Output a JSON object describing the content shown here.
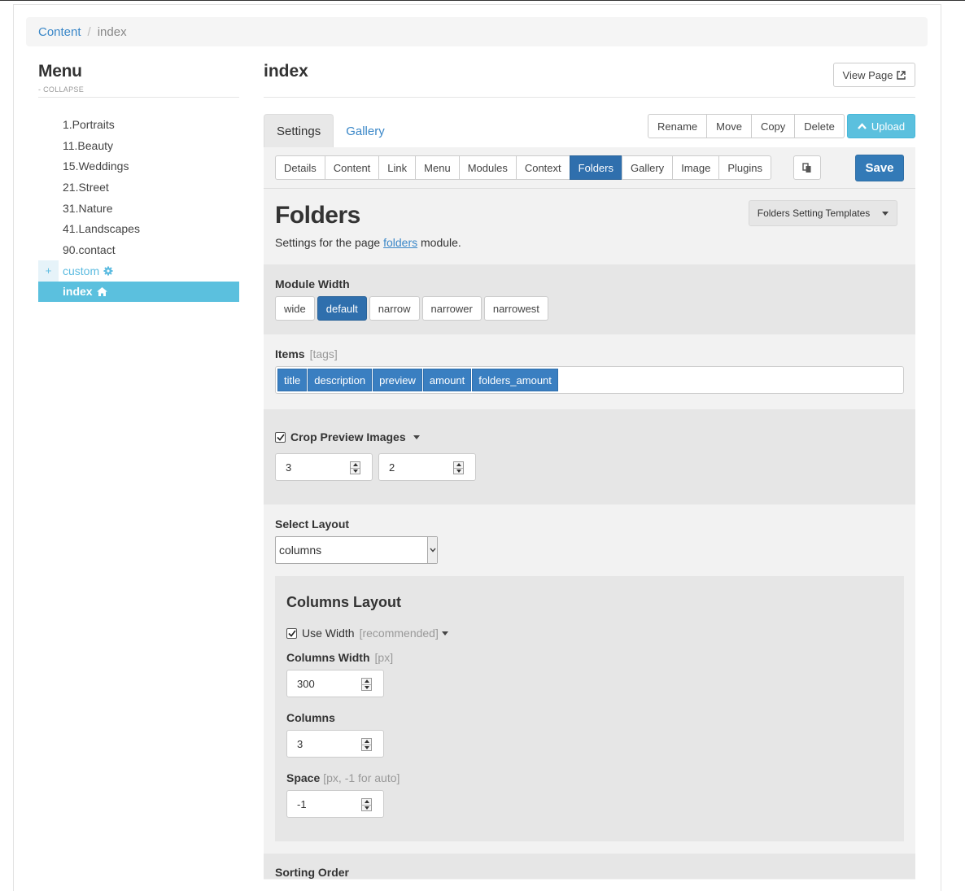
{
  "breadcrumb": {
    "root": "Content",
    "separator": "/",
    "current": "index"
  },
  "sidebar": {
    "title": "Menu",
    "collapse": "- COLLAPSE",
    "items": [
      {
        "label": "1.Portraits"
      },
      {
        "label": "11.Beauty"
      },
      {
        "label": "15.Weddings"
      },
      {
        "label": "21.Street"
      },
      {
        "label": "31.Nature"
      },
      {
        "label": "41.Landscapes"
      },
      {
        "label": "90.contact"
      },
      {
        "label": "custom",
        "expander": "+"
      },
      {
        "label": "index"
      }
    ]
  },
  "header": {
    "title": "index",
    "view_page": "View Page"
  },
  "tabs": {
    "settings": "Settings",
    "gallery": "Gallery"
  },
  "actions": {
    "rename": "Rename",
    "move": "Move",
    "copy": "Copy",
    "delete": "Delete",
    "upload": "Upload"
  },
  "subtabs": [
    "Details",
    "Content",
    "Link",
    "Menu",
    "Modules",
    "Context",
    "Folders",
    "Gallery",
    "Image",
    "Plugins"
  ],
  "save": "Save",
  "module": {
    "title": "Folders",
    "desc_prefix": "Settings for the page ",
    "desc_link": "folders",
    "desc_suffix": " module.",
    "templates": "Folders Setting Templates"
  },
  "module_width": {
    "label": "Module Width",
    "options": [
      "wide",
      "default",
      "narrow",
      "narrower",
      "narrowest"
    ],
    "selected": "default"
  },
  "items": {
    "label": "Items",
    "hint": "[tags]",
    "tags": [
      "title",
      "description",
      "preview",
      "amount",
      "folders_amount"
    ]
  },
  "crop": {
    "label": "Crop Preview Images",
    "checked": true,
    "value1": "3",
    "value2": "2"
  },
  "layout": {
    "label": "Select Layout",
    "value": "columns"
  },
  "columns_layout": {
    "title": "Columns Layout",
    "use_width": {
      "label": "Use Width",
      "hint": "[recommended]",
      "checked": true
    },
    "width": {
      "label": "Columns Width",
      "hint": "[px]",
      "value": "300"
    },
    "columns": {
      "label": "Columns",
      "value": "3"
    },
    "space": {
      "label": "Space",
      "hint": "[px, -1 for auto]",
      "value": "-1"
    }
  },
  "sorting": {
    "label": "Sorting Order"
  },
  "colors": {
    "accent": "#3a87c8",
    "primary": "#337ab7",
    "info": "#5bc0de"
  }
}
